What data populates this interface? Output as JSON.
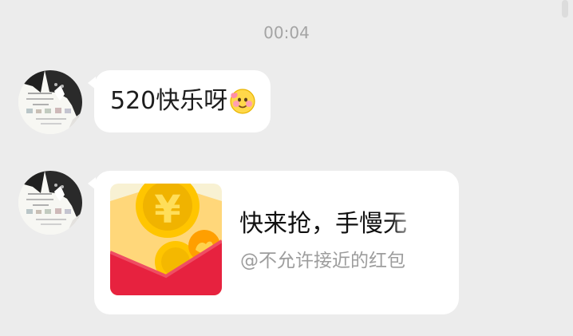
{
  "timestamp": "00:04",
  "messages": [
    {
      "type": "text",
      "text": "520快乐呀"
    },
    {
      "type": "red_packet",
      "title": "快来抢，手慢无",
      "subtitle": "@不允许接近的红包"
    }
  ],
  "icons": {
    "emoji": "blushing-face-icon",
    "packet": "red-envelope-coin-icon"
  },
  "colors": {
    "background": "#ececec",
    "bubble": "#ffffff",
    "packet_red": "#e7223f",
    "coin_yellow": "#f4b800",
    "coin_orange": "#ff9b00"
  }
}
